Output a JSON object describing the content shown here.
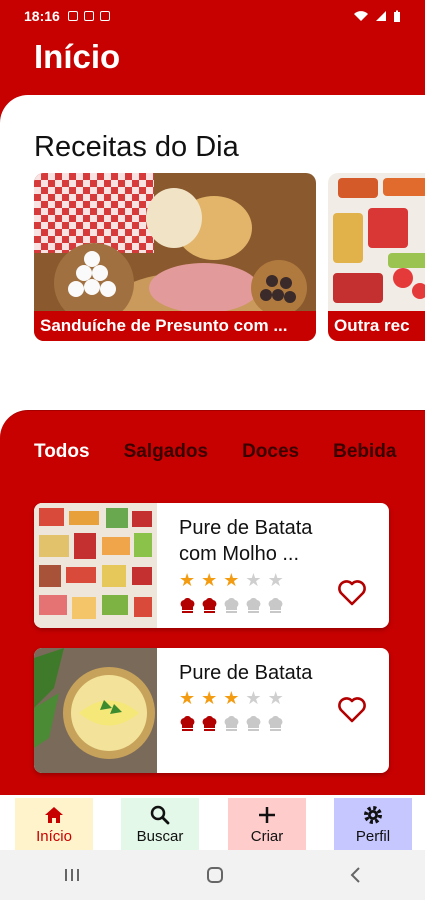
{
  "status_bar": {
    "time": "18:16"
  },
  "header": {
    "title": "Início"
  },
  "daily": {
    "section_title": "Receitas do Dia",
    "cards": [
      {
        "caption": "Sanduíche de Presunto com ..."
      },
      {
        "caption": "Outra rec"
      }
    ]
  },
  "categories": {
    "tabs": [
      "Todos",
      "Salgados",
      "Doces",
      "Bebida"
    ],
    "active": "Todos"
  },
  "recipes": [
    {
      "title": "Pure de Batata com Molho ...",
      "rating": 3,
      "difficulty": 2,
      "favorite": false
    },
    {
      "title": "Pure de Batata",
      "rating": 3,
      "difficulty": 2,
      "favorite": false
    }
  ],
  "bottom_nav": [
    {
      "label": "Início",
      "icon": "home-icon",
      "bg": "#fff3cc",
      "active": true
    },
    {
      "label": "Buscar",
      "icon": "search-icon",
      "bg": "#e3f8e8"
    },
    {
      "label": "Criar",
      "icon": "plus-icon",
      "bg": "#ffcccc"
    },
    {
      "label": "Perfil",
      "icon": "gear-icon",
      "bg": "#c7c7ff"
    }
  ],
  "colors": {
    "primary": "#c70000",
    "star": "#f39c12"
  }
}
